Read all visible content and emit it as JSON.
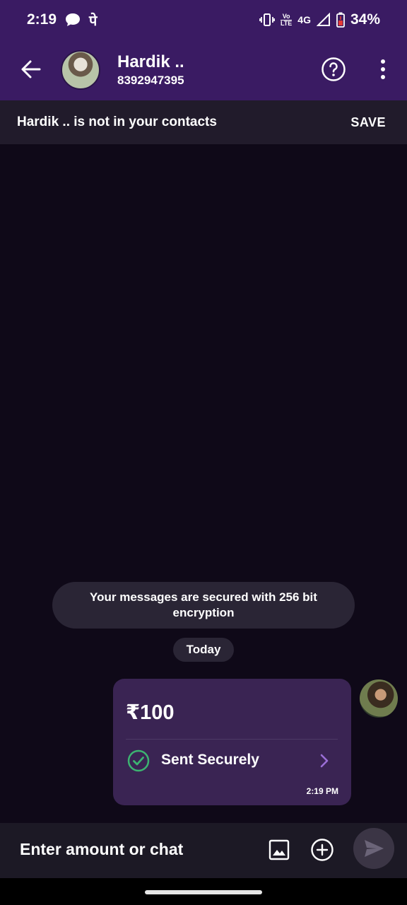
{
  "status_bar": {
    "time": "2:19",
    "app_glyph": "पे",
    "network": "4G",
    "volte_top": "Vo",
    "volte_bottom": "LTE",
    "battery": "34%",
    "icons": [
      "chat-bubble-icon",
      "vibrate-icon",
      "volte-icon",
      "signal-icon",
      "battery-low-icon"
    ]
  },
  "header": {
    "name": "Hardik  ..",
    "phone": "8392947395",
    "icons": [
      "back-arrow-icon",
      "help-circle-icon",
      "more-vert-icon"
    ]
  },
  "banner": {
    "message": "Hardik  .. is not in your contacts",
    "save_label": "SAVE"
  },
  "chat": {
    "encryption_note": "Your messages are secured with 256 bit encryption",
    "date_chip": "Today",
    "payment": {
      "amount": "₹100",
      "status": "Sent Securely",
      "time": "2:19 PM",
      "accent_color": "#3a2453",
      "status_color": "#3cb371"
    }
  },
  "composer": {
    "placeholder": "Enter amount or chat",
    "icons": [
      "image-icon",
      "add-circle-icon",
      "send-icon"
    ]
  },
  "colors": {
    "brand": "#3a1b63",
    "background": "#0f0918",
    "banner_bg": "#211b2b"
  }
}
